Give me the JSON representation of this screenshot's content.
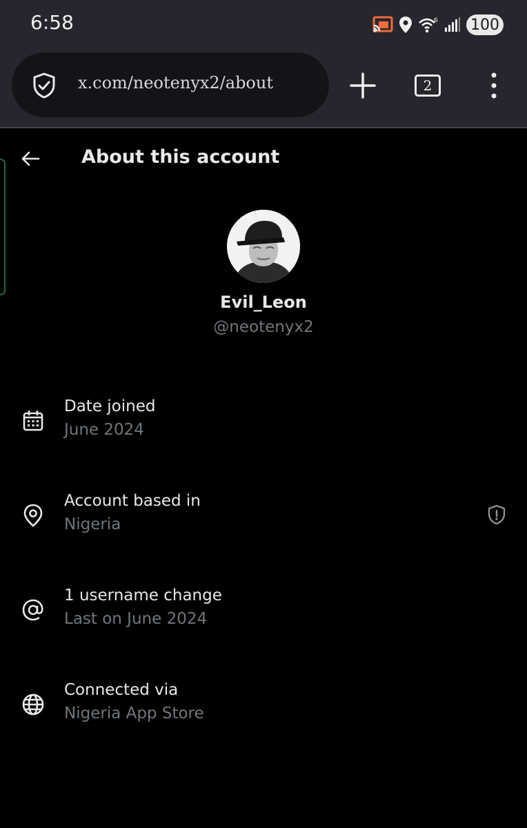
{
  "status_bar": {
    "time": "6:58",
    "icons": [
      "cast-icon",
      "location-icon",
      "wifi-6-icon",
      "signal-icon"
    ],
    "battery": "100",
    "accent_cast": "#f26b3a"
  },
  "browser": {
    "url": "x.com/neotenyx2/about",
    "tab_count": "2"
  },
  "page": {
    "title": "About this account",
    "profile": {
      "display_name": "Evil_Leon",
      "handle": "@neotenyx2"
    },
    "rows": [
      {
        "icon": "calendar-icon",
        "label": "Date joined",
        "value": "June 2024"
      },
      {
        "icon": "location-pin-icon",
        "label": "Account based in",
        "value": "Nigeria"
      },
      {
        "icon": "at-sign-icon",
        "label": "1 username change",
        "value": "Last on June 2024"
      },
      {
        "icon": "globe-icon",
        "label": "Connected via",
        "value": "Nigeria App Store"
      }
    ]
  },
  "colors": {
    "background": "#000000",
    "chrome": "#27262e",
    "primary_text": "#e7e9ea",
    "secondary_text": "#71767b",
    "side_tab_border": "#1f6b39"
  }
}
